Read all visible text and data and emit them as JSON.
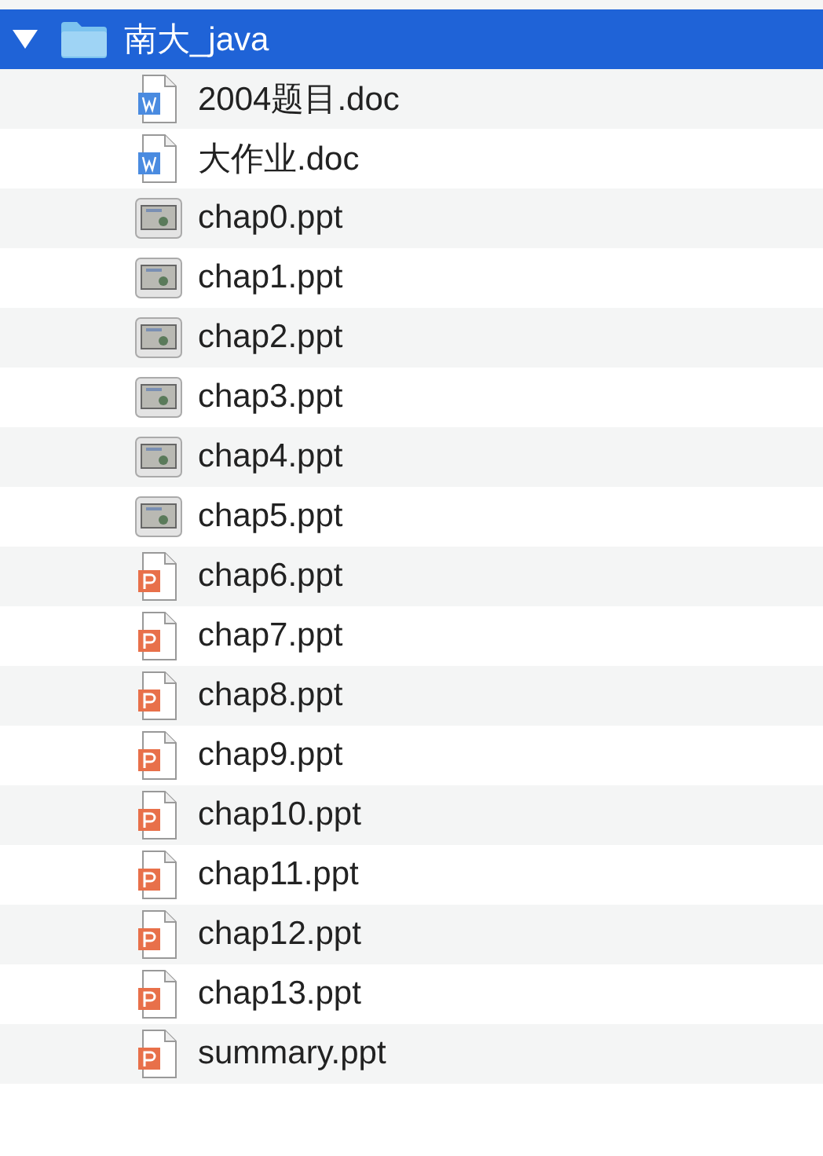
{
  "folder": {
    "name": "南大_java",
    "expanded": true,
    "selected": true,
    "children": [
      {
        "name": "2004题目.doc",
        "kind": "word",
        "selected": false
      },
      {
        "name": "大作业.doc",
        "kind": "word",
        "selected": false
      },
      {
        "name": "chap0.ppt",
        "kind": "thumbnail",
        "selected": false
      },
      {
        "name": "chap1.ppt",
        "kind": "thumbnail",
        "selected": false
      },
      {
        "name": "chap2.ppt",
        "kind": "thumbnail",
        "selected": false
      },
      {
        "name": "chap3.ppt",
        "kind": "thumbnail",
        "selected": false
      },
      {
        "name": "chap4.ppt",
        "kind": "thumbnail",
        "selected": false
      },
      {
        "name": "chap5.ppt",
        "kind": "thumbnail",
        "selected": false
      },
      {
        "name": "chap6.ppt",
        "kind": "powerpoint",
        "selected": false
      },
      {
        "name": "chap7.ppt",
        "kind": "powerpoint",
        "selected": false
      },
      {
        "name": "chap8.ppt",
        "kind": "powerpoint",
        "selected": false
      },
      {
        "name": "chap9.ppt",
        "kind": "powerpoint",
        "selected": false
      },
      {
        "name": "chap10.ppt",
        "kind": "powerpoint",
        "selected": false
      },
      {
        "name": "chap11.ppt",
        "kind": "powerpoint",
        "selected": false
      },
      {
        "name": "chap12.ppt",
        "kind": "powerpoint",
        "selected": false
      },
      {
        "name": "chap13.ppt",
        "kind": "powerpoint",
        "selected": false
      },
      {
        "name": "summary.ppt",
        "kind": "powerpoint",
        "selected": false
      }
    ]
  }
}
